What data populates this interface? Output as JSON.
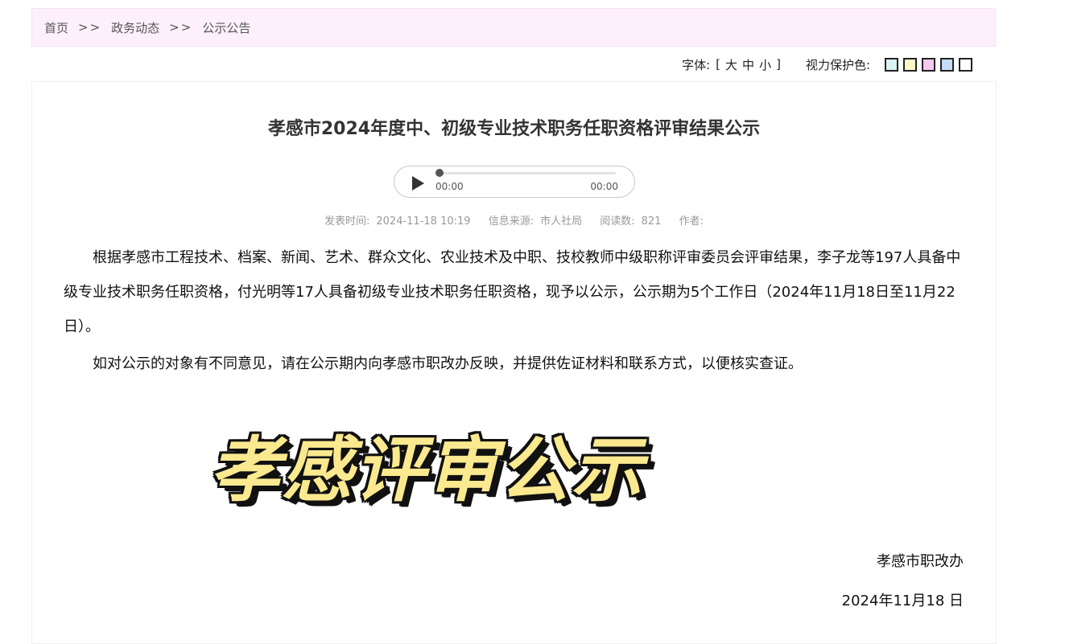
{
  "breadcrumb": {
    "home": "首页",
    "separator": ">>",
    "section": "政务动态",
    "current": "公示公告"
  },
  "tools": {
    "font_label": "字体:",
    "bracket_open": "[",
    "font_large": "大",
    "font_medium": "中",
    "font_small": "小",
    "bracket_close": "]",
    "eye_label": "视力保护色:",
    "colors": [
      "#d8f4f2",
      "#fdf8c8",
      "#f7c9f1",
      "#c5dcf9",
      "#ffffff"
    ]
  },
  "article": {
    "title": "孝感市2024年度中、初级专业技术职务任职资格评审结果公示",
    "player": {
      "current": "00:00",
      "total": "00:00",
      "progress": 0
    },
    "meta": {
      "time_label": "发表时间:",
      "time_value": "2024-11-18 10:19",
      "source_label": "信息来源:",
      "source_value": "市人社局",
      "views_label": "阅读数:",
      "views_value": "821",
      "author_label": "作者:"
    },
    "paragraphs": [
      "根据孝感市工程技术、档案、新闻、艺术、群众文化、农业技术及中职、技校教师中级职称评审委员会评审结果，李子龙等197人具备中级专业技术职务任职资格，付光明等17人具备初级专业技术职务任职资格，现予以公示，公示期为5个工作日（2024年11月18日至11月22 日）。",
      "如对公示的对象有不同意见，请在公示期内向孝感市职改办反映，并提供佐证材料和联系方式，以便核实查证。"
    ],
    "banner_text": "孝感评审公示",
    "signature_org": "孝感市职改办",
    "signature_date": "2024年11月18 日"
  }
}
